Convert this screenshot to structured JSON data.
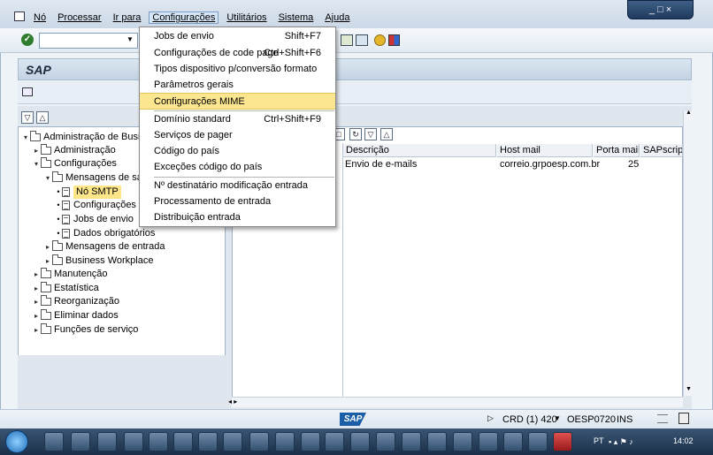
{
  "menubar": {
    "items": [
      {
        "label": "Nó"
      },
      {
        "label": "Processar"
      },
      {
        "label": "Ir para"
      },
      {
        "label": "Configurações"
      },
      {
        "label": "Utilitários"
      },
      {
        "label": "Sistema"
      },
      {
        "label": "Ajuda"
      }
    ]
  },
  "window_controls": {
    "label": "_ □ ×"
  },
  "header": {
    "title": "SAP"
  },
  "dropdown": {
    "items": [
      {
        "label": "Jobs de envio",
        "shortcut": "Shift+F7"
      },
      {
        "label": "Configurações de code page",
        "shortcut": "Ctrl+Shift+F6"
      },
      {
        "label": "Tipos dispositivo p/conversão formato",
        "shortcut": ""
      },
      {
        "label": "Parâmetros gerais",
        "shortcut": ""
      },
      {
        "label": "Configurações MIME",
        "shortcut": ""
      },
      {
        "label": "Domínio standard",
        "shortcut": "Ctrl+Shift+F9"
      },
      {
        "label": "Serviços de pager",
        "shortcut": ""
      },
      {
        "label": "Código do país",
        "shortcut": ""
      },
      {
        "label": "Exceções código do país",
        "shortcut": ""
      },
      {
        "label": "Nº destinatário modificação entrada",
        "shortcut": ""
      },
      {
        "label": "Processamento de entrada",
        "shortcut": ""
      },
      {
        "label": "Distribuição entrada",
        "shortcut": ""
      }
    ]
  },
  "tree": {
    "items": [
      {
        "label": "Administração de Busines"
      },
      {
        "label": "Administração"
      },
      {
        "label": "Configurações"
      },
      {
        "label": "Mensagens de saída"
      },
      {
        "label": "Nó SMTP"
      },
      {
        "label": "Configurações"
      },
      {
        "label": "Jobs de envio"
      },
      {
        "label": "Dados obrigatórios"
      },
      {
        "label": "Mensagens de entrada"
      },
      {
        "label": "Business Workplace"
      },
      {
        "label": "Manutenção"
      },
      {
        "label": "Estatística"
      },
      {
        "label": "Reorganização"
      },
      {
        "label": "Eliminar dados"
      },
      {
        "label": "Funções de serviço"
      }
    ]
  },
  "table": {
    "columns": [
      "Descrição",
      "Host mail",
      "Porta mail",
      "SAPscrip..."
    ],
    "rows": [
      {
        "descricao": "Envio de e-mails",
        "host": "correio.grpoesp.com.br",
        "porta": "25",
        "sapscript": ""
      }
    ]
  },
  "statusbar": {
    "logo": "SAP",
    "system": "CRD (1) 420",
    "server": "OESP0720",
    "mode": "INS"
  },
  "taskbar": {
    "language": "PT",
    "time": "14:02"
  },
  "colors": {
    "selection_highlight": "#fce68f",
    "taskbar": "#1a2f48"
  }
}
